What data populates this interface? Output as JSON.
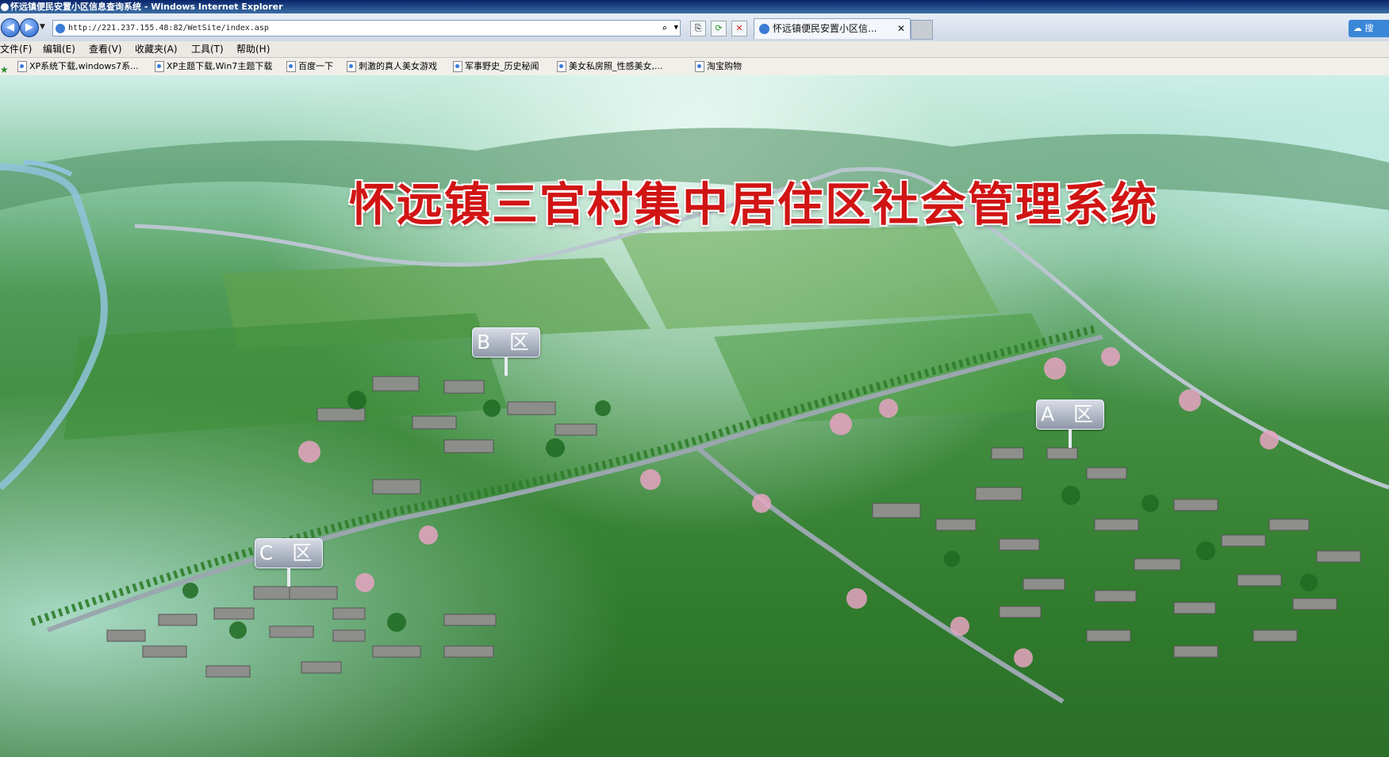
{
  "window": {
    "title": "怀远镇便民安置小区信息查询系统 - Windows Internet Explorer"
  },
  "nav": {
    "back_icon": "back-arrow-icon",
    "forward_icon": "forward-arrow-icon",
    "address": "http://221.237.155.48:82/WetSite/index.asp",
    "tab_title": "怀远镇便民安置小区信...",
    "tab_close": "✕",
    "right_button_label": "搜"
  },
  "menu": {
    "items": [
      "文件(F)",
      "编辑(E)",
      "查看(V)",
      "收藏夹(A)",
      "工具(T)",
      "帮助(H)"
    ]
  },
  "favorites": {
    "items": [
      "XP系统下载,windows7系...",
      "XP主题下载,Win7主题下载",
      "百度一下",
      "刺激的真人美女游戏",
      "军事野史_历史秘闻",
      "美女私房照_性感美女,...",
      "淘宝购物"
    ]
  },
  "page": {
    "title": "怀远镇三官村集中居住区社会管理系统",
    "zones": [
      {
        "id": "B",
        "label": "B 区"
      },
      {
        "id": "A",
        "label": "A 区"
      },
      {
        "id": "C",
        "label": "C 区"
      }
    ]
  },
  "colors": {
    "title_red": "#d11414",
    "titlebar_blue": "#0a246a"
  }
}
